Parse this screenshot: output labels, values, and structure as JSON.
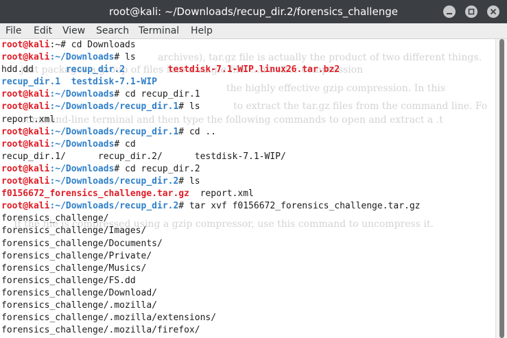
{
  "window": {
    "title": "root@kali: ~/Downloads/recup_dir.2/forensics_challenge"
  },
  "menu": [
    "File",
    "Edit",
    "View",
    "Search",
    "Terminal",
    "Help"
  ],
  "terminal": {
    "lines": [
      [
        {
          "t": "root@kali",
          "c": "red"
        },
        {
          "t": ":~# cd Downloads",
          "c": ""
        }
      ],
      [
        {
          "t": "root@kali",
          "c": "red"
        },
        {
          "t": ":~/Downloads",
          "c": "blue"
        },
        {
          "t": "# ls",
          "c": ""
        }
      ],
      [
        {
          "t": "hdd.dd      ",
          "c": ""
        },
        {
          "t": "recup_dir.2",
          "c": "blue"
        },
        {
          "t": "        ",
          "c": ""
        },
        {
          "t": "testdisk-7.1-WIP.linux26.tar.bz2",
          "c": "red"
        }
      ],
      [
        {
          "t": "recup_dir.1",
          "c": "blue"
        },
        {
          "t": "  ",
          "c": ""
        },
        {
          "t": "testdisk-7.1-WIP",
          "c": "blue"
        }
      ],
      [
        {
          "t": "root@kali",
          "c": "red"
        },
        {
          "t": ":~/Downloads",
          "c": "blue"
        },
        {
          "t": "# cd recup_dir.1",
          "c": ""
        }
      ],
      [
        {
          "t": "root@kali",
          "c": "red"
        },
        {
          "t": ":~/Downloads/recup_dir.1",
          "c": "blue"
        },
        {
          "t": "# ls",
          "c": ""
        }
      ],
      [
        {
          "t": "report.xml",
          "c": ""
        }
      ],
      [
        {
          "t": "root@kali",
          "c": "red"
        },
        {
          "t": ":~/Downloads/recup_dir.1",
          "c": "blue"
        },
        {
          "t": "# cd ..",
          "c": ""
        }
      ],
      [
        {
          "t": "root@kali",
          "c": "red"
        },
        {
          "t": ":~/Downloads",
          "c": "blue"
        },
        {
          "t": "# cd",
          "c": ""
        }
      ],
      [
        {
          "t": "recup_dir.1/      recup_dir.2/      testdisk-7.1-WIP/",
          "c": ""
        }
      ],
      [
        {
          "t": "root@kali",
          "c": "red"
        },
        {
          "t": ":~/Downloads",
          "c": "blue"
        },
        {
          "t": "# cd recup_dir.2",
          "c": ""
        }
      ],
      [
        {
          "t": "root@kali",
          "c": "red"
        },
        {
          "t": ":~/Downloads/recup_dir.2",
          "c": "blue"
        },
        {
          "t": "# ls",
          "c": ""
        }
      ],
      [
        {
          "t": "f0156672_forensics_challenge.tar.gz",
          "c": "red"
        },
        {
          "t": "  report.xml",
          "c": ""
        }
      ],
      [
        {
          "t": "root@kali",
          "c": "red"
        },
        {
          "t": ":~/Downloads/recup_dir.2",
          "c": "blue"
        },
        {
          "t": "# tar xvf f0156672_forensics_challenge.tar.gz",
          "c": ""
        }
      ],
      [
        {
          "t": "forensics_challenge/",
          "c": ""
        }
      ],
      [
        {
          "t": "forensics_challenge/Images/",
          "c": ""
        }
      ],
      [
        {
          "t": "forensics_challenge/Documents/",
          "c": ""
        }
      ],
      [
        {
          "t": "forensics_challenge/Private/",
          "c": ""
        }
      ],
      [
        {
          "t": "forensics_challenge/Musics/",
          "c": ""
        }
      ],
      [
        {
          "t": "forensics_challenge/FS.dd",
          "c": ""
        }
      ],
      [
        {
          "t": "forensics_challenge/Download/",
          "c": ""
        }
      ],
      [
        {
          "t": "forensics_challenge/.mozilla/",
          "c": ""
        }
      ],
      [
        {
          "t": "forensics_challenge/.mozilla/extensions/",
          "c": ""
        }
      ],
      [
        {
          "t": "forensics_challenge/.mozilla/firefox/",
          "c": ""
        }
      ]
    ],
    "ghost_lines": [
      "archives), tar.gz file is actually the product of two different things.",
      "just packages a group of files into a single file. ...n't offer compression",
      "the highly effective gzip compression. In this",
      "to extract the tar.gz files from the command line. Fo",
      "command-line terminal and then type the following commands to open and extract a .t",
      "If the file is compressed using a gzip compressor, use this command to uncompress it."
    ]
  }
}
